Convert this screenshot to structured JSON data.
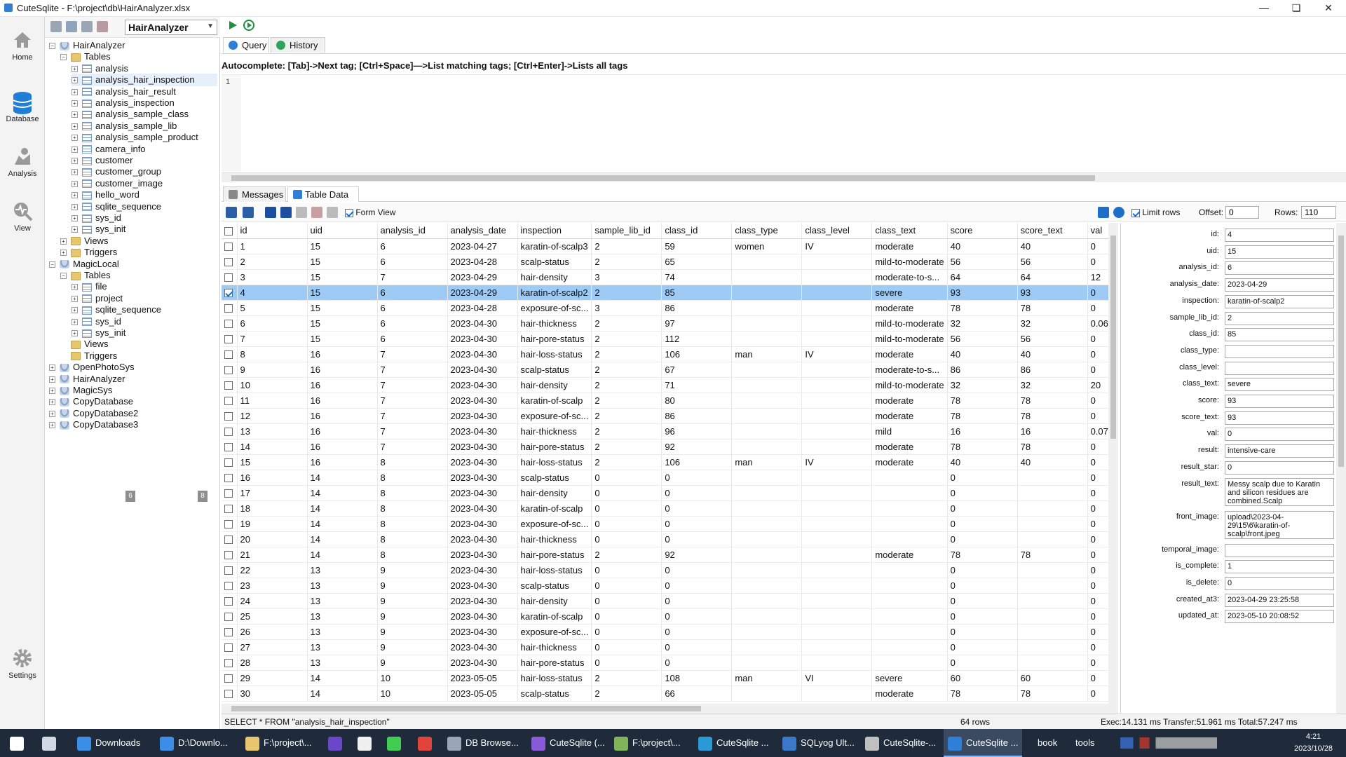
{
  "window": {
    "title": "CuteSqlite - F:\\project\\db\\HairAnalyzer.xlsx"
  },
  "leftnav": [
    {
      "label": "Home",
      "icon": "home-icon"
    },
    {
      "label": "Database",
      "icon": "database-icon"
    },
    {
      "label": "Analysis",
      "icon": "analysis-icon"
    },
    {
      "label": "View",
      "icon": "view-icon"
    },
    {
      "label": "Settings",
      "icon": "settings-icon"
    }
  ],
  "tree": {
    "selected_db": "HairAnalyzer",
    "nodes": [
      {
        "label": "HairAnalyzer",
        "type": "db",
        "depth": 0,
        "exp": "−"
      },
      {
        "label": "Tables",
        "type": "folder",
        "depth": 1,
        "exp": "−"
      },
      {
        "label": "analysis",
        "type": "table",
        "depth": 2,
        "exp": "+"
      },
      {
        "label": "analysis_hair_inspection",
        "type": "table",
        "depth": 2,
        "exp": "+"
      },
      {
        "label": "analysis_hair_result",
        "type": "table",
        "depth": 2,
        "exp": "+"
      },
      {
        "label": "analysis_inspection",
        "type": "table",
        "depth": 2,
        "exp": "+"
      },
      {
        "label": "analysis_sample_class",
        "type": "table",
        "depth": 2,
        "exp": "+"
      },
      {
        "label": "analysis_sample_lib",
        "type": "table",
        "depth": 2,
        "exp": "+"
      },
      {
        "label": "analysis_sample_product",
        "type": "table",
        "depth": 2,
        "exp": "+"
      },
      {
        "label": "camera_info",
        "type": "table",
        "depth": 2,
        "exp": "+"
      },
      {
        "label": "customer",
        "type": "table",
        "depth": 2,
        "exp": "+"
      },
      {
        "label": "customer_group",
        "type": "table",
        "depth": 2,
        "exp": "+"
      },
      {
        "label": "customer_image",
        "type": "table",
        "depth": 2,
        "exp": "+"
      },
      {
        "label": "hello_word",
        "type": "table",
        "depth": 2,
        "exp": "+"
      },
      {
        "label": "sqlite_sequence",
        "type": "table",
        "depth": 2,
        "exp": "+"
      },
      {
        "label": "sys_id",
        "type": "table",
        "depth": 2,
        "exp": "+"
      },
      {
        "label": "sys_init",
        "type": "table",
        "depth": 2,
        "exp": "+"
      },
      {
        "label": "Views",
        "type": "folder",
        "depth": 1,
        "exp": "+"
      },
      {
        "label": "Triggers",
        "type": "folder",
        "depth": 1,
        "exp": "+"
      },
      {
        "label": "MagicLocal",
        "type": "db",
        "depth": 0,
        "exp": "−"
      },
      {
        "label": "Tables",
        "type": "folder",
        "depth": 1,
        "exp": "−"
      },
      {
        "label": "file",
        "type": "table",
        "depth": 2,
        "exp": "+"
      },
      {
        "label": "project",
        "type": "table",
        "depth": 2,
        "exp": "+"
      },
      {
        "label": "sqlite_sequence",
        "type": "table",
        "depth": 2,
        "exp": "+"
      },
      {
        "label": "sys_id",
        "type": "table",
        "depth": 2,
        "exp": "+"
      },
      {
        "label": "sys_init",
        "type": "table",
        "depth": 2,
        "exp": "+"
      },
      {
        "label": "Views",
        "type": "folder",
        "depth": 1,
        "exp": ""
      },
      {
        "label": "Triggers",
        "type": "folder",
        "depth": 1,
        "exp": ""
      },
      {
        "label": "OpenPhotoSys",
        "type": "db",
        "depth": 0,
        "exp": "+"
      },
      {
        "label": "HairAnalyzer",
        "type": "db",
        "depth": 0,
        "exp": "+"
      },
      {
        "label": "MagicSys",
        "type": "db",
        "depth": 0,
        "exp": "+"
      },
      {
        "label": "CopyDatabase",
        "type": "db",
        "depth": 0,
        "exp": "+"
      },
      {
        "label": "CopyDatabase2",
        "type": "db",
        "depth": 0,
        "exp": "+"
      },
      {
        "label": "CopyDatabase3",
        "type": "db",
        "depth": 0,
        "exp": "+"
      }
    ],
    "scroll_left": "6",
    "scroll_right": "8"
  },
  "tabs": {
    "query": "Query",
    "history": "History"
  },
  "autocomplete_hint": "Autocomplete: [Tab]->Next tag; [Ctrl+Space]—>List matching tags; [Ctrl+Enter]->Lists all tags",
  "editor": {
    "line": "1"
  },
  "result_tabs": {
    "messages": "Messages",
    "table_data": "Table Data"
  },
  "gridtoolbar": {
    "form_view": "Form View",
    "limit_rows": "Limit rows",
    "offset_label": "Offset:",
    "offset": "0",
    "rows_label": "Rows:",
    "rows": "110"
  },
  "grid": {
    "columns": [
      "id",
      "uid",
      "analysis_id",
      "analysis_date",
      "inspection",
      "sample_lib_id",
      "class_id",
      "class_type",
      "class_level",
      "class_text",
      "score",
      "score_text",
      "val"
    ],
    "selected_index": 3,
    "rows": [
      [
        "1",
        "15",
        "6",
        "2023-04-27",
        "karatin-of-scalp3",
        "2",
        "59",
        "women",
        "IV",
        "moderate",
        "40",
        "40",
        "0"
      ],
      [
        "2",
        "15",
        "6",
        "2023-04-28",
        "scalp-status",
        "2",
        "65",
        "",
        "",
        "mild-to-moderate",
        "56",
        "56",
        "0"
      ],
      [
        "3",
        "15",
        "7",
        "2023-04-29",
        "hair-density",
        "3",
        "74",
        "",
        "",
        "moderate-to-s...",
        "64",
        "64",
        "12"
      ],
      [
        "4",
        "15",
        "6",
        "2023-04-29",
        "karatin-of-scalp2",
        "2",
        "85",
        "",
        "",
        "severe",
        "93",
        "93",
        "0"
      ],
      [
        "5",
        "15",
        "6",
        "2023-04-28",
        "exposure-of-sc...",
        "3",
        "86",
        "",
        "",
        "moderate",
        "78",
        "78",
        "0"
      ],
      [
        "6",
        "15",
        "6",
        "2023-04-30",
        "hair-thickness",
        "2",
        "97",
        "",
        "",
        "mild-to-moderate",
        "32",
        "32",
        "0.06"
      ],
      [
        "7",
        "15",
        "6",
        "2023-04-30",
        "hair-pore-status",
        "2",
        "112",
        "",
        "",
        "mild-to-moderate",
        "56",
        "56",
        "0"
      ],
      [
        "8",
        "16",
        "7",
        "2023-04-30",
        "hair-loss-status",
        "2",
        "106",
        "man",
        "IV",
        "moderate",
        "40",
        "40",
        "0"
      ],
      [
        "9",
        "16",
        "7",
        "2023-04-30",
        "scalp-status",
        "2",
        "67",
        "",
        "",
        "moderate-to-s...",
        "86",
        "86",
        "0"
      ],
      [
        "10",
        "16",
        "7",
        "2023-04-30",
        "hair-density",
        "2",
        "71",
        "",
        "",
        "mild-to-moderate",
        "32",
        "32",
        "20"
      ],
      [
        "11",
        "16",
        "7",
        "2023-04-30",
        "karatin-of-scalp",
        "2",
        "80",
        "",
        "",
        "moderate",
        "78",
        "78",
        "0"
      ],
      [
        "12",
        "16",
        "7",
        "2023-04-30",
        "exposure-of-sc...",
        "2",
        "86",
        "",
        "",
        "moderate",
        "78",
        "78",
        "0"
      ],
      [
        "13",
        "16",
        "7",
        "2023-04-30",
        "hair-thickness",
        "2",
        "96",
        "",
        "",
        "mild",
        "16",
        "16",
        "0.07"
      ],
      [
        "14",
        "16",
        "7",
        "2023-04-30",
        "hair-pore-status",
        "2",
        "92",
        "",
        "",
        "moderate",
        "78",
        "78",
        "0"
      ],
      [
        "15",
        "16",
        "8",
        "2023-04-30",
        "hair-loss-status",
        "2",
        "106",
        "man",
        "IV",
        "moderate",
        "40",
        "40",
        "0"
      ],
      [
        "16",
        "14",
        "8",
        "2023-04-30",
        "scalp-status",
        "0",
        "0",
        "",
        "",
        "",
        "0",
        "",
        "0"
      ],
      [
        "17",
        "14",
        "8",
        "2023-04-30",
        "hair-density",
        "0",
        "0",
        "",
        "",
        "",
        "0",
        "",
        "0"
      ],
      [
        "18",
        "14",
        "8",
        "2023-04-30",
        "karatin-of-scalp",
        "0",
        "0",
        "",
        "",
        "",
        "0",
        "",
        "0"
      ],
      [
        "19",
        "14",
        "8",
        "2023-04-30",
        "exposure-of-sc...",
        "0",
        "0",
        "",
        "",
        "",
        "0",
        "",
        "0"
      ],
      [
        "20",
        "14",
        "8",
        "2023-04-30",
        "hair-thickness",
        "0",
        "0",
        "",
        "",
        "",
        "0",
        "",
        "0"
      ],
      [
        "21",
        "14",
        "8",
        "2023-04-30",
        "hair-pore-status",
        "2",
        "92",
        "",
        "",
        "moderate",
        "78",
        "78",
        "0"
      ],
      [
        "22",
        "13",
        "9",
        "2023-04-30",
        "hair-loss-status",
        "0",
        "0",
        "",
        "",
        "",
        "0",
        "",
        "0"
      ],
      [
        "23",
        "13",
        "9",
        "2023-04-30",
        "scalp-status",
        "0",
        "0",
        "",
        "",
        "",
        "0",
        "",
        "0"
      ],
      [
        "24",
        "13",
        "9",
        "2023-04-30",
        "hair-density",
        "0",
        "0",
        "",
        "",
        "",
        "0",
        "",
        "0"
      ],
      [
        "25",
        "13",
        "9",
        "2023-04-30",
        "karatin-of-scalp",
        "0",
        "0",
        "",
        "",
        "",
        "0",
        "",
        "0"
      ],
      [
        "26",
        "13",
        "9",
        "2023-04-30",
        "exposure-of-sc...",
        "0",
        "0",
        "",
        "",
        "",
        "0",
        "",
        "0"
      ],
      [
        "27",
        "13",
        "9",
        "2023-04-30",
        "hair-thickness",
        "0",
        "0",
        "",
        "",
        "",
        "0",
        "",
        "0"
      ],
      [
        "28",
        "13",
        "9",
        "2023-04-30",
        "hair-pore-status",
        "0",
        "0",
        "",
        "",
        "",
        "0",
        "",
        "0"
      ],
      [
        "29",
        "14",
        "10",
        "2023-05-05",
        "hair-loss-status",
        "2",
        "108",
        "man",
        "VI",
        "severe",
        "60",
        "60",
        "0"
      ],
      [
        "30",
        "14",
        "10",
        "2023-05-05",
        "scalp-status",
        "2",
        "66",
        "",
        "",
        "moderate",
        "78",
        "78",
        "0"
      ]
    ]
  },
  "form": [
    {
      "label": "id:",
      "value": "4"
    },
    {
      "label": "uid:",
      "value": "15"
    },
    {
      "label": "analysis_id:",
      "value": "6"
    },
    {
      "label": "analysis_date:",
      "value": "2023-04-29"
    },
    {
      "label": "inspection:",
      "value": "karatin-of-scalp2"
    },
    {
      "label": "sample_lib_id:",
      "value": "2"
    },
    {
      "label": "class_id:",
      "value": "85"
    },
    {
      "label": "class_type:",
      "value": ""
    },
    {
      "label": "class_level:",
      "value": ""
    },
    {
      "label": "class_text:",
      "value": "severe"
    },
    {
      "label": "score:",
      "value": "93"
    },
    {
      "label": "score_text:",
      "value": "93"
    },
    {
      "label": "val:",
      "value": "0"
    },
    {
      "label": "result:",
      "value": "intensive-care"
    },
    {
      "label": "result_star:",
      "value": "0"
    },
    {
      "label": "result_text:",
      "value": "Messy scalp due to Karatin and silicon residues are combined.Scalp",
      "tall": true
    },
    {
      "label": "front_image:",
      "value": "upload\\2023-04-29\\15\\6\\karatin-of-scalp\\front.jpeg",
      "tall": true
    },
    {
      "label": "temporal_image:",
      "value": ""
    },
    {
      "label": "is_complete:",
      "value": "1"
    },
    {
      "label": "is_delete:",
      "value": "0"
    },
    {
      "label": "created_at3:",
      "value": "2023-04-29 23:25:58"
    },
    {
      "label": "updated_at:",
      "value": "2023-05-10 20:08:52"
    }
  ],
  "status": {
    "sql": "SELECT * FROM \"analysis_hair_inspection\"",
    "rows": "64 rows",
    "timing": "Exec:14.131 ms Transfer:51.961 ms Total:57.247 ms"
  },
  "taskbar": [
    {
      "label": "",
      "icon": "start-icon"
    },
    {
      "label": "",
      "icon": "taskview-icon"
    },
    {
      "label": "Downloads",
      "icon": "download-icon"
    },
    {
      "label": "D:\\Downlo...",
      "icon": "download-icon"
    },
    {
      "label": "F:\\project\\...",
      "icon": "folder-icon"
    },
    {
      "label": "",
      "icon": "app-icon"
    },
    {
      "label": "",
      "icon": "unreal-icon"
    },
    {
      "label": "",
      "icon": "qt-icon"
    },
    {
      "label": "",
      "icon": "chrome-icon"
    },
    {
      "label": "DB Browse...",
      "icon": "dbbrowser-icon"
    },
    {
      "label": "CuteSqlite (...",
      "icon": "vs-icon"
    },
    {
      "label": "F:\\project\\...",
      "icon": "notepad-icon"
    },
    {
      "label": "CuteSqlite ...",
      "icon": "edge-icon"
    },
    {
      "label": "SQLyog Ult...",
      "icon": "sqlyog-icon"
    },
    {
      "label": "CuteSqlite-...",
      "icon": "app2-icon"
    },
    {
      "label": "CuteSqlite ...",
      "icon": "cutesqlite-icon"
    },
    {
      "label": "book",
      "icon": ""
    },
    {
      "label": "tools",
      "icon": ""
    }
  ],
  "clock": {
    "time": "4:21",
    "date": "2023/10/28"
  },
  "colors": {
    "selection": "#9ecbf5",
    "accent": "#2f7fd6",
    "taskbar": "#1f2a3a"
  }
}
